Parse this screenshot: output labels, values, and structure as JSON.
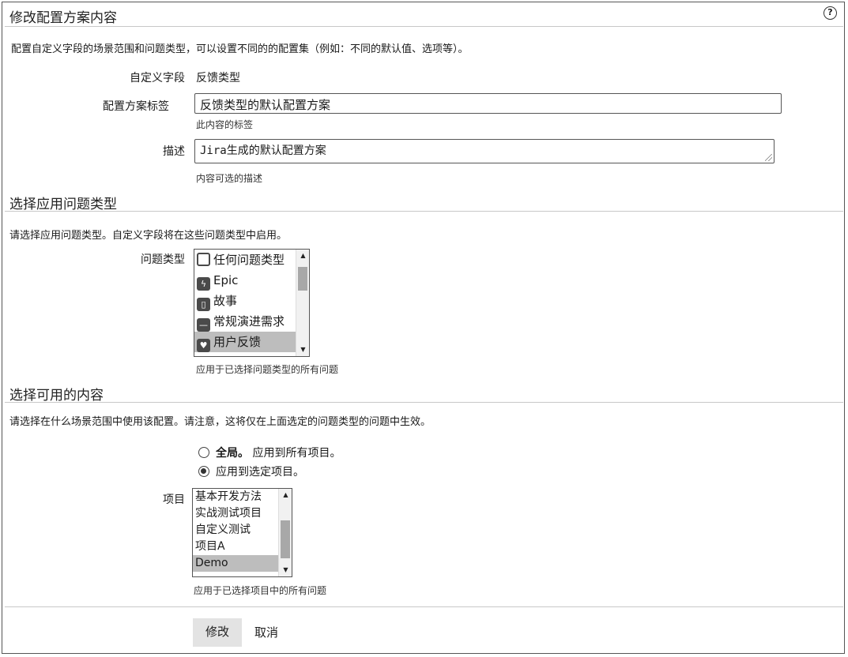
{
  "header": {
    "title": "修改配置方案内容",
    "help_icon": "?"
  },
  "intro": "配置自定义字段的场景范围和问题类型，可以设置不同的的配置集（例如：不同的默认值、选项等）。",
  "custom_field": {
    "label": "自定义字段",
    "value": "反馈类型"
  },
  "scheme_label": {
    "label": "配置方案标签",
    "value": "反馈类型的默认配置方案",
    "hint": "此内容的标签"
  },
  "description": {
    "label": "描述",
    "value": "Jira生成的默认配置方案",
    "hint": "内容可选的描述"
  },
  "issue_types_section": {
    "title": "选择应用问题类型",
    "intro": "请选择应用问题类型。自定义字段将在这些问题类型中启用。",
    "label": "问题类型",
    "options": [
      {
        "label": "任何问题类型",
        "icon": "any-issue-icon",
        "selected": false
      },
      {
        "label": "Epic",
        "icon": "epic-lightning-icon",
        "selected": false
      },
      {
        "label": "故事",
        "icon": "story-bookmark-icon",
        "selected": false
      },
      {
        "label": "常规演进需求",
        "icon": "minus-icon",
        "selected": false
      },
      {
        "label": "用户反馈",
        "icon": "heart-icon",
        "selected": true
      }
    ],
    "hint": "应用于已选择问题类型的所有问题"
  },
  "context_section": {
    "title": "选择可用的内容",
    "intro": "请选择在什么场景范围中使用该配置。请注意，这将仅在上面选定的问题类型的问题中生效。",
    "global_bold": "全局。",
    "global_text": "应用到所有项目。",
    "selected_text": "应用到选定项目。",
    "global_checked": false,
    "selected_checked": true,
    "projects_label": "项目",
    "projects": [
      {
        "label": "基本开发方法",
        "selected": false
      },
      {
        "label": "实战测试项目",
        "selected": false
      },
      {
        "label": "自定义测试",
        "selected": false
      },
      {
        "label": "项目A",
        "selected": false
      },
      {
        "label": "Demo",
        "selected": true
      }
    ],
    "projects_hint": "应用于已选择项目中的所有问题"
  },
  "actions": {
    "submit": "修改",
    "cancel": "取消"
  }
}
